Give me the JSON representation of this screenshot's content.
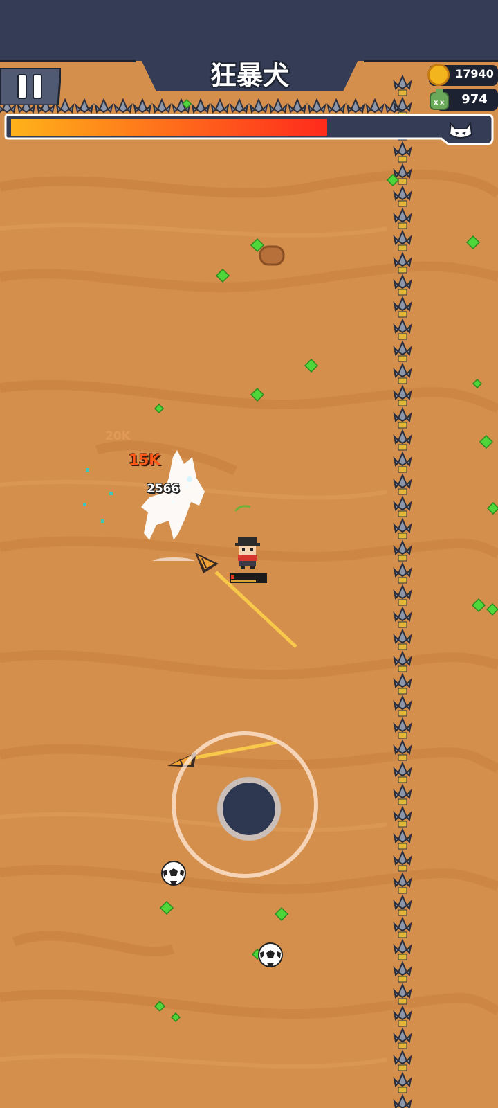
{
  "hud": {
    "boss_name": "狂暴犬",
    "coins": "17940",
    "kills": "974",
    "boss_hp_fraction": 0.66
  },
  "damage_numbers": {
    "faded": "20K",
    "big": "15K",
    "small": "2566"
  },
  "player": {
    "hp_fraction": 0.1
  },
  "colors": {
    "sand": "#d58f4c",
    "hud_dark": "#343d55",
    "hp_start": "#ffb21a",
    "hp_end": "#ff2a1c",
    "gem": "#4fd63a"
  },
  "icons": [
    "pause-icon",
    "coin-icon",
    "kill-skull-icon",
    "boss-skull-icon",
    "soccer-ball-icon",
    "drill-icon",
    "gem-icon"
  ]
}
